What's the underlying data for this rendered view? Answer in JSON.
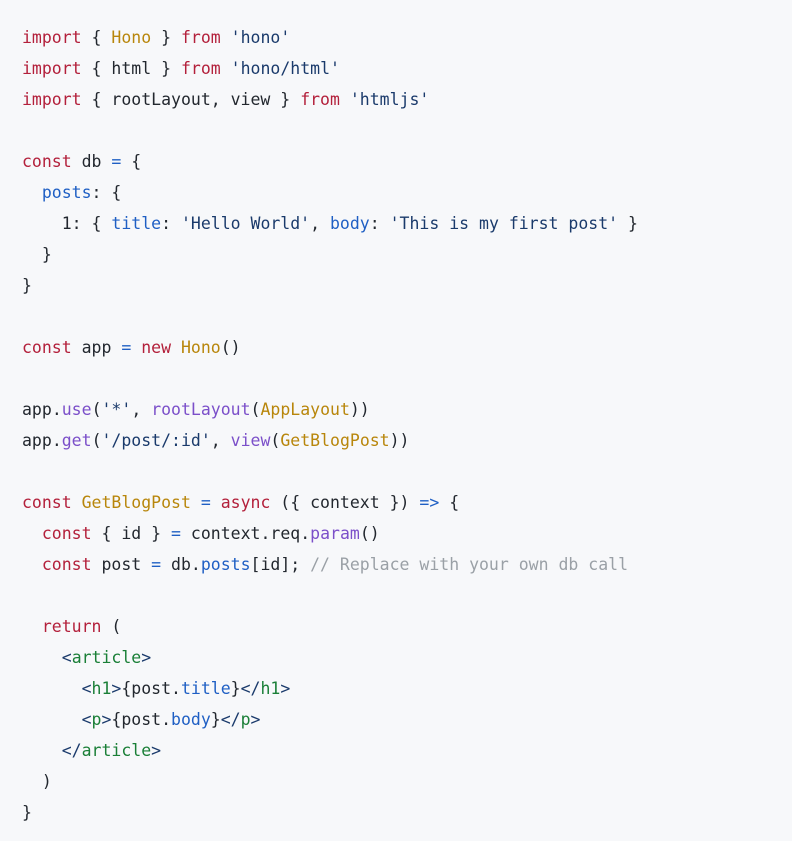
{
  "editor": {
    "language": "jsx",
    "background": "#f7f8fa",
    "colors": {
      "keyword": "#b3203b",
      "type": "#b8860b",
      "string": "#1a3a6b",
      "plain": "#22272e",
      "property": "#1f5fc4",
      "function": "#7b4fc9",
      "comment": "#9aa0a6",
      "tag": "#1a7f37",
      "operator": "#1f5fc4"
    },
    "plain_text": "import { Hono } from 'hono'\nimport { html } from 'hono/html'\nimport { rootLayout, view } from 'htmljs'\n\nconst db = {\n  posts: {\n    1: { title: 'Hello World', body: 'This is my first post' }\n  }\n}\n\nconst app = new Hono()\n\napp.use('*', rootLayout(AppLayout))\napp.get('/post/:id', view(GetBlogPost))\n\nconst GetBlogPost = async ({ context }) => {\n  const { id } = context.req.param()\n  const post = db.posts[id]; // Replace with your own db call\n\n  return (\n    <article>\n      <h1>{post.title}</h1>\n      <p>{post.body}</p>\n    </article>\n  )\n}",
    "lines": [
      [
        {
          "t": "keyword",
          "v": "import"
        },
        {
          "t": "punct",
          "v": " { "
        },
        {
          "t": "type",
          "v": "Hono"
        },
        {
          "t": "punct",
          "v": " } "
        },
        {
          "t": "keyword",
          "v": "from"
        },
        {
          "t": "plain",
          "v": " "
        },
        {
          "t": "string",
          "v": "'hono'"
        }
      ],
      [
        {
          "t": "keyword",
          "v": "import"
        },
        {
          "t": "punct",
          "v": " { "
        },
        {
          "t": "plain",
          "v": "html"
        },
        {
          "t": "punct",
          "v": " } "
        },
        {
          "t": "keyword",
          "v": "from"
        },
        {
          "t": "plain",
          "v": " "
        },
        {
          "t": "string",
          "v": "'hono/html'"
        }
      ],
      [
        {
          "t": "keyword",
          "v": "import"
        },
        {
          "t": "punct",
          "v": " { "
        },
        {
          "t": "plain",
          "v": "rootLayout, view"
        },
        {
          "t": "punct",
          "v": " } "
        },
        {
          "t": "keyword",
          "v": "from"
        },
        {
          "t": "plain",
          "v": " "
        },
        {
          "t": "string",
          "v": "'htmljs'"
        }
      ],
      [],
      [
        {
          "t": "keyword",
          "v": "const"
        },
        {
          "t": "plain",
          "v": " db "
        },
        {
          "t": "operator",
          "v": "="
        },
        {
          "t": "punct",
          "v": " {"
        }
      ],
      [
        {
          "t": "plain",
          "v": "  "
        },
        {
          "t": "prop",
          "v": "posts"
        },
        {
          "t": "punct",
          "v": ": {"
        }
      ],
      [
        {
          "t": "plain",
          "v": "    1"
        },
        {
          "t": "punct",
          "v": ": { "
        },
        {
          "t": "prop",
          "v": "title"
        },
        {
          "t": "punct",
          "v": ": "
        },
        {
          "t": "string",
          "v": "'Hello World'"
        },
        {
          "t": "punct",
          "v": ", "
        },
        {
          "t": "prop",
          "v": "body"
        },
        {
          "t": "punct",
          "v": ": "
        },
        {
          "t": "string",
          "v": "'This is my first post'"
        },
        {
          "t": "punct",
          "v": " }"
        }
      ],
      [
        {
          "t": "punct",
          "v": "  }"
        }
      ],
      [
        {
          "t": "punct",
          "v": "}"
        }
      ],
      [],
      [
        {
          "t": "keyword",
          "v": "const"
        },
        {
          "t": "plain",
          "v": " app "
        },
        {
          "t": "operator",
          "v": "="
        },
        {
          "t": "plain",
          "v": " "
        },
        {
          "t": "keyword",
          "v": "new"
        },
        {
          "t": "plain",
          "v": " "
        },
        {
          "t": "type",
          "v": "Hono"
        },
        {
          "t": "punct",
          "v": "()"
        }
      ],
      [],
      [
        {
          "t": "plain",
          "v": "app"
        },
        {
          "t": "punct",
          "v": "."
        },
        {
          "t": "func",
          "v": "use"
        },
        {
          "t": "punct",
          "v": "("
        },
        {
          "t": "string",
          "v": "'*'"
        },
        {
          "t": "punct",
          "v": ", "
        },
        {
          "t": "func",
          "v": "rootLayout"
        },
        {
          "t": "punct",
          "v": "("
        },
        {
          "t": "type",
          "v": "AppLayout"
        },
        {
          "t": "punct",
          "v": "))"
        }
      ],
      [
        {
          "t": "plain",
          "v": "app"
        },
        {
          "t": "punct",
          "v": "."
        },
        {
          "t": "func",
          "v": "get"
        },
        {
          "t": "punct",
          "v": "("
        },
        {
          "t": "string",
          "v": "'/post/:id'"
        },
        {
          "t": "punct",
          "v": ", "
        },
        {
          "t": "func",
          "v": "view"
        },
        {
          "t": "punct",
          "v": "("
        },
        {
          "t": "type",
          "v": "GetBlogPost"
        },
        {
          "t": "punct",
          "v": "))"
        }
      ],
      [],
      [
        {
          "t": "keyword",
          "v": "const"
        },
        {
          "t": "plain",
          "v": " "
        },
        {
          "t": "type",
          "v": "GetBlogPost"
        },
        {
          "t": "plain",
          "v": " "
        },
        {
          "t": "operator",
          "v": "="
        },
        {
          "t": "plain",
          "v": " "
        },
        {
          "t": "keyword",
          "v": "async"
        },
        {
          "t": "punct",
          "v": " ({ "
        },
        {
          "t": "plain",
          "v": "context"
        },
        {
          "t": "punct",
          "v": " }) "
        },
        {
          "t": "operator",
          "v": "=>"
        },
        {
          "t": "punct",
          "v": " {"
        }
      ],
      [
        {
          "t": "plain",
          "v": "  "
        },
        {
          "t": "keyword",
          "v": "const"
        },
        {
          "t": "punct",
          "v": " { "
        },
        {
          "t": "plain",
          "v": "id"
        },
        {
          "t": "punct",
          "v": " } "
        },
        {
          "t": "operator",
          "v": "="
        },
        {
          "t": "plain",
          "v": " context"
        },
        {
          "t": "punct",
          "v": "."
        },
        {
          "t": "plain",
          "v": "req"
        },
        {
          "t": "punct",
          "v": "."
        },
        {
          "t": "func",
          "v": "param"
        },
        {
          "t": "punct",
          "v": "()"
        }
      ],
      [
        {
          "t": "plain",
          "v": "  "
        },
        {
          "t": "keyword",
          "v": "const"
        },
        {
          "t": "plain",
          "v": " post "
        },
        {
          "t": "operator",
          "v": "="
        },
        {
          "t": "plain",
          "v": " db"
        },
        {
          "t": "punct",
          "v": "."
        },
        {
          "t": "prop",
          "v": "posts"
        },
        {
          "t": "punct",
          "v": "[id];"
        },
        {
          "t": "plain",
          "v": " "
        },
        {
          "t": "comment",
          "v": "// Replace with your own db call"
        }
      ],
      [],
      [
        {
          "t": "plain",
          "v": "  "
        },
        {
          "t": "keyword",
          "v": "return"
        },
        {
          "t": "punct",
          "v": " ("
        }
      ],
      [
        {
          "t": "plain",
          "v": "    "
        },
        {
          "t": "bracket",
          "v": "<"
        },
        {
          "t": "tag",
          "v": "article"
        },
        {
          "t": "bracket",
          "v": ">"
        }
      ],
      [
        {
          "t": "plain",
          "v": "      "
        },
        {
          "t": "bracket",
          "v": "<"
        },
        {
          "t": "tag",
          "v": "h1"
        },
        {
          "t": "bracket",
          "v": ">"
        },
        {
          "t": "punct",
          "v": "{"
        },
        {
          "t": "plain",
          "v": "post"
        },
        {
          "t": "punct",
          "v": "."
        },
        {
          "t": "prop",
          "v": "title"
        },
        {
          "t": "punct",
          "v": "}"
        },
        {
          "t": "bracket",
          "v": "</"
        },
        {
          "t": "tag",
          "v": "h1"
        },
        {
          "t": "bracket",
          "v": ">"
        }
      ],
      [
        {
          "t": "plain",
          "v": "      "
        },
        {
          "t": "bracket",
          "v": "<"
        },
        {
          "t": "tag",
          "v": "p"
        },
        {
          "t": "bracket",
          "v": ">"
        },
        {
          "t": "punct",
          "v": "{"
        },
        {
          "t": "plain",
          "v": "post"
        },
        {
          "t": "punct",
          "v": "."
        },
        {
          "t": "prop",
          "v": "body"
        },
        {
          "t": "punct",
          "v": "}"
        },
        {
          "t": "bracket",
          "v": "</"
        },
        {
          "t": "tag",
          "v": "p"
        },
        {
          "t": "bracket",
          "v": ">"
        }
      ],
      [
        {
          "t": "plain",
          "v": "    "
        },
        {
          "t": "bracket",
          "v": "</"
        },
        {
          "t": "tag",
          "v": "article"
        },
        {
          "t": "bracket",
          "v": ">"
        }
      ],
      [
        {
          "t": "punct",
          "v": "  )"
        }
      ],
      [
        {
          "t": "punct",
          "v": "}"
        }
      ]
    ]
  }
}
